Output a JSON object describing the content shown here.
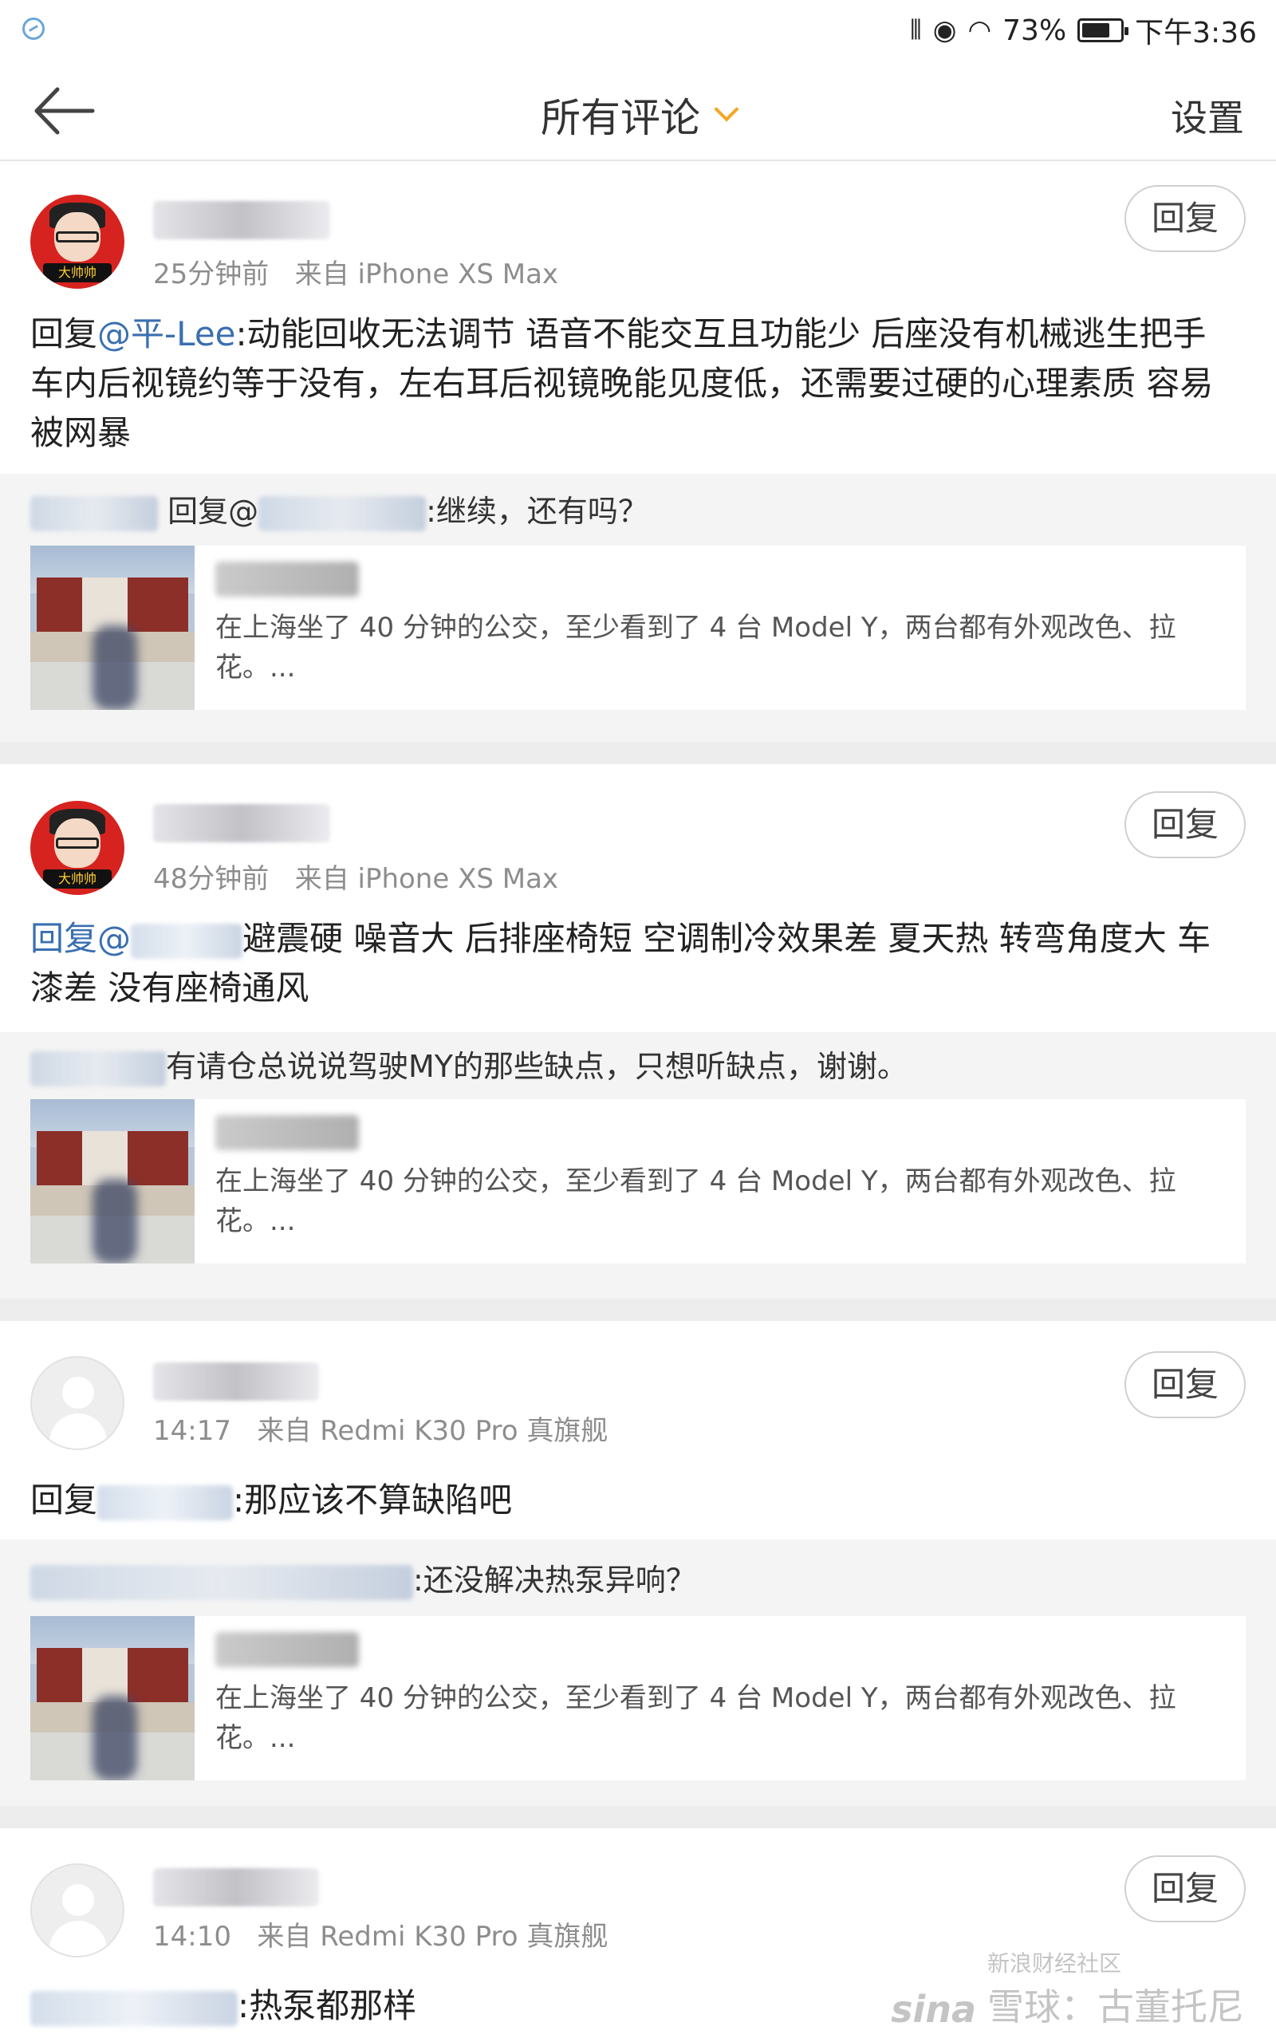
{
  "status_bar": {
    "icons": [
      "vibrate-icon",
      "eye-icon",
      "wifi-icon"
    ],
    "battery_percent_text": "73%",
    "battery_level": 0.73,
    "time": "下午3:36"
  },
  "nav": {
    "title": "所有评论",
    "settings_label": "设置"
  },
  "comments": [
    {
      "time": "25分钟前",
      "source": "来自 iPhone XS Max",
      "reply_label": "回复",
      "reply_prefix": "回复",
      "mention": "@平-Lee",
      "text": ":动能回收无法调节 语音不能交互且功能少 后座没有机械逃生把手 车内后视镜约等于没有，左右耳后视镜晚能见度低，还需要过硬的心理素质 容易被网暴",
      "quote": {
        "prefix_reply": "回复@",
        "text": ":继续，还有吗？"
      },
      "card_text": "在上海坐了 40 分钟的公交，至少看到了 4 台 Model Y，两台都有外观改色、拉花。..."
    },
    {
      "time": "48分钟前",
      "source": "来自 iPhone XS Max",
      "reply_label": "回复",
      "reply_prefix": "回复@",
      "text": "避震硬 噪音大 后排座椅短 空调制冷效果差 夏天热 转弯角度大 车漆差 没有座椅通风",
      "quote": {
        "text": "有请仓总说说驾驶MY的那些缺点，只想听缺点，谢谢。"
      },
      "card_text": "在上海坐了 40 分钟的公交，至少看到了 4 台 Model Y，两台都有外观改色、拉花。..."
    },
    {
      "time": "14:17",
      "source": "来自 Redmi K30 Pro 真旗舰",
      "reply_label": "回复",
      "reply_prefix": "回复",
      "text": ":那应该不算缺陷吧",
      "quote": {
        "text": ":还没解决热泵异响？"
      },
      "card_text": "在上海坐了 40 分钟的公交，至少看到了 4 台 Model Y，两台都有外观改色、拉花。..."
    },
    {
      "time": "14:10",
      "source": "来自 Redmi K30 Pro 真旗舰",
      "reply_label": "回复",
      "text": ":热泵都那样"
    }
  ],
  "watermark": {
    "logo": "sina",
    "sub": "新浪财经社区",
    "main": "雪球：古董托尼"
  }
}
